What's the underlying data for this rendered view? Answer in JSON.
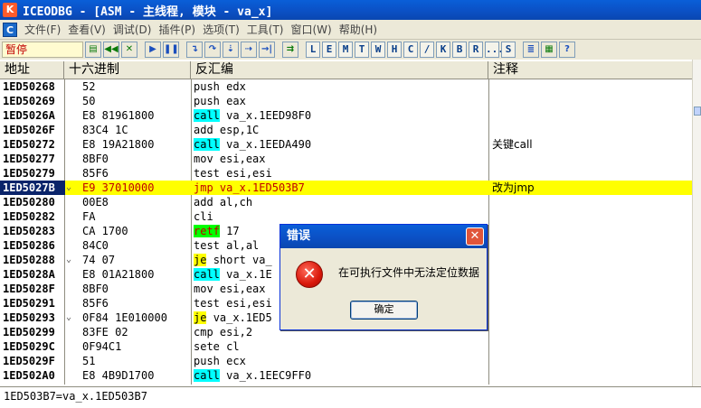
{
  "window": {
    "title": "ICEODBG - [ASM - 主线程, 模块 - va_x]",
    "icon_letter": "K"
  },
  "menu": {
    "logo": "C",
    "items": [
      "文件(F)",
      "查看(V)",
      "调试(D)",
      "插件(P)",
      "选项(T)",
      "工具(T)",
      "窗口(W)",
      "帮助(H)"
    ]
  },
  "toolbar": {
    "status": "暂停",
    "letters": [
      "L",
      "E",
      "M",
      "T",
      "W",
      "H",
      "C",
      "/",
      "K",
      "B",
      "R",
      "...",
      "S"
    ]
  },
  "columns": {
    "address": "地址",
    "hex": "十六进制",
    "disasm": "反汇编",
    "comment": "注释"
  },
  "rows": [
    {
      "addr": "1ED50268",
      "hex": "52",
      "mn": "push",
      "ops": "edx",
      "cmt": ""
    },
    {
      "addr": "1ED50269",
      "hex": "50",
      "mn": "push",
      "ops": "eax",
      "cmt": ""
    },
    {
      "addr": "1ED5026A",
      "hex": "E8 81961800",
      "mn": "call",
      "ops": "va_x.1EED98F0",
      "cmt": ""
    },
    {
      "addr": "1ED5026F",
      "hex": "83C4 1C",
      "mn": "add",
      "ops": "esp,1C",
      "cmt": ""
    },
    {
      "addr": "1ED50272",
      "hex": "E8 19A21800",
      "mn": "call",
      "ops": "va_x.1EEDA490",
      "cmt": "关键call"
    },
    {
      "addr": "1ED50277",
      "hex": "8BF0",
      "mn": "mov",
      "ops": "esi,eax",
      "cmt": ""
    },
    {
      "addr": "1ED50279",
      "hex": "85F6",
      "mn": "test",
      "ops": "esi,esi",
      "cmt": ""
    },
    {
      "addr": "1ED5027B",
      "mark": "⌄",
      "hex": "E9 37010000",
      "mn": "jmp",
      "ops": "va_x.1ED503B7",
      "cmt": "改为jmp"
    },
    {
      "addr": "1ED50280",
      "hex": "00E8",
      "mn": "add",
      "ops": "al,ch",
      "cmt": ""
    },
    {
      "addr": "1ED50282",
      "hex": "FA",
      "mn": "cli",
      "ops": "",
      "cmt": ""
    },
    {
      "addr": "1ED50283",
      "hex": "CA 1700",
      "mn": "retf",
      "ops": "17",
      "cmt": ""
    },
    {
      "addr": "1ED50286",
      "hex": "84C0",
      "mn": "test",
      "ops": "al,al",
      "cmt": ""
    },
    {
      "addr": "1ED50288",
      "mark": "⌄",
      "hex": "74 07",
      "mn": "je",
      "ops": "short va_",
      "cmt": ""
    },
    {
      "addr": "1ED5028A",
      "hex": "E8 01A21800",
      "mn": "call",
      "ops": "va_x.1E",
      "cmt": ""
    },
    {
      "addr": "1ED5028F",
      "hex": "8BF0",
      "mn": "mov",
      "ops": "esi,eax",
      "cmt": ""
    },
    {
      "addr": "1ED50291",
      "hex": "85F6",
      "mn": "test",
      "ops": "esi,esi",
      "cmt": ""
    },
    {
      "addr": "1ED50293",
      "mark": "⌄",
      "hex": "0F84 1E010000",
      "mn": "je",
      "ops": "va_x.1ED5",
      "cmt": ""
    },
    {
      "addr": "1ED50299",
      "hex": "83FE 02",
      "mn": "cmp",
      "ops": "esi,2",
      "cmt": ""
    },
    {
      "addr": "1ED5029C",
      "hex": "0F94C1",
      "mn": "sete",
      "ops": "cl",
      "cmt": ""
    },
    {
      "addr": "1ED5029F",
      "hex": "51",
      "mn": "push",
      "ops": "ecx",
      "cmt": ""
    },
    {
      "addr": "1ED502A0",
      "hex": "E8 4B9D1700",
      "mn": "call",
      "ops": "va_x.1EEC9FF0",
      "cmt": ""
    }
  ],
  "selected_index": 7,
  "statusbar": {
    "text": "1ED503B7=va_x.1ED503B7"
  },
  "dialog": {
    "title": "错误",
    "message": "在可执行文件中无法定位数据",
    "ok_label": "确定",
    "close_glyph": "✕",
    "icon": "error-icon"
  },
  "colors": {
    "call": "#00ffff",
    "je": "#ffff00",
    "retf": "#00ff00",
    "highlight": "#ffff00",
    "selection": "#0a246a"
  }
}
